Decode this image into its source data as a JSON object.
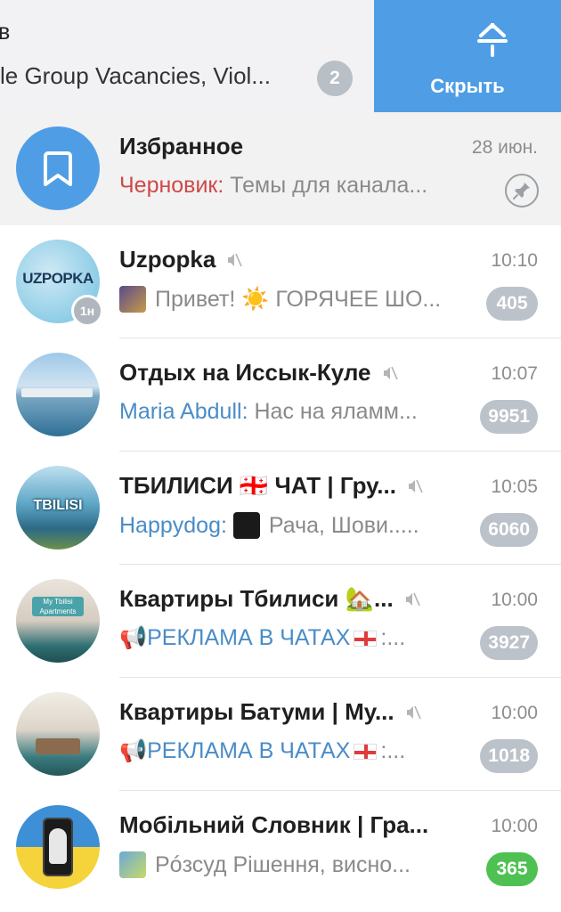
{
  "archive": {
    "title_fragment": "в",
    "subtitle": "le Group Vacancies, Viol...",
    "badge": "2",
    "action_label": "Скрыть",
    "action_icon": "unpin-arrow-icon"
  },
  "chats": [
    {
      "name": "Избранное",
      "time": "28 июн.",
      "draft_label": "Черновик:",
      "message": "Темы для канала...",
      "pinned": true,
      "avatar": "bookmark-icon"
    },
    {
      "name": "Uzpopka",
      "time": "10:10",
      "message": "Привет! ☀️ ГОРЯЧЕЕ ШО...",
      "badge": "405",
      "muted": true,
      "avatar_text": "UZPOPKA",
      "avatar_sub": "1н"
    },
    {
      "name": "Отдых на Иссык-Куле",
      "time": "10:07",
      "sender": "Maria Abdull:",
      "message": "Нас на яламм...",
      "badge": "9951",
      "muted": true
    },
    {
      "name": "ТБИЛИСИ 🇬🇪 ЧАТ | Гру...",
      "time": "10:05",
      "sender": "Happydog:",
      "message": "Рача, Шови.....",
      "badge": "6060",
      "muted": true,
      "avatar_text": "TBILISI"
    },
    {
      "name": "Квартиры Тбилиси 🏡...",
      "time": "10:00",
      "message_prefix": "📢РЕКЛАМА В ЧАТАХ",
      "message_suffix": ":...",
      "badge": "3927",
      "muted": true,
      "avatar_text": "My Tbilisi Apartments"
    },
    {
      "name": "Квартиры Батуми | Му...",
      "time": "10:00",
      "message_prefix": "📢РЕКЛАМА В ЧАТАХ",
      "message_suffix": ":...",
      "badge": "1018",
      "muted": true
    },
    {
      "name": "Мобільний Словник | Гра...",
      "time": "10:00",
      "message": "Рóзсуд  Рішення, висно...",
      "badge": "365",
      "badge_color": "#4fc153"
    }
  ],
  "colors": {
    "accent": "#4f9ee5",
    "link": "#4a8cc7",
    "draft": "#d04848",
    "badge_muted": "#bcc2c9",
    "badge_active": "#4fc153"
  }
}
